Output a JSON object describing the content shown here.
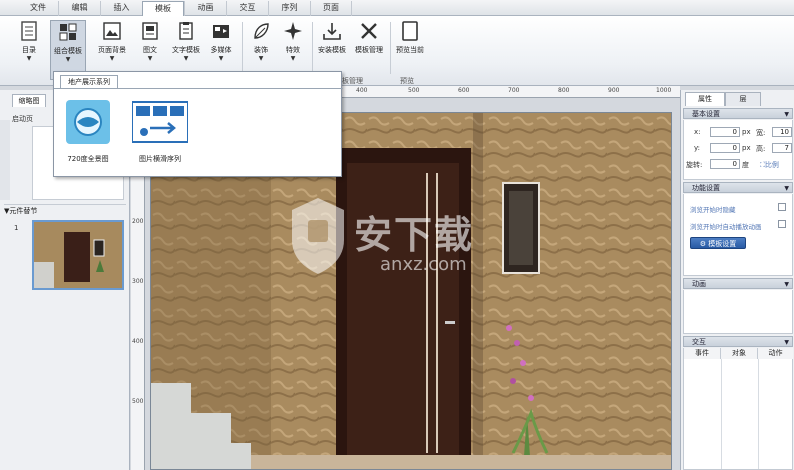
{
  "menu": {
    "tabs": [
      "文件",
      "编辑",
      "插入",
      "模板",
      "动画",
      "交互",
      "序列",
      "页面"
    ],
    "active": "模板"
  },
  "ribbon": {
    "buttons": [
      {
        "label": "目录"
      },
      {
        "label": "组合模板"
      },
      {
        "label": "页面背景"
      },
      {
        "label": "图文"
      },
      {
        "label": "文字模板"
      },
      {
        "label": "多媒体"
      },
      {
        "label": "装饰"
      },
      {
        "label": "特效"
      },
      {
        "label": "安装模板"
      },
      {
        "label": "模板管理"
      },
      {
        "label": "预览当前"
      }
    ],
    "groups": [
      "板管理",
      "预览"
    ]
  },
  "popup": {
    "tab": "地产展示系列",
    "items": [
      {
        "label": "720度全景图"
      },
      {
        "label": "图片横滑序列"
      }
    ]
  },
  "left_panel": {
    "tab": "缩略图",
    "start_page": "启动页",
    "section": "元件替节",
    "page_number": "1"
  },
  "ruler": {
    "h": [
      "400",
      "500",
      "600",
      "700",
      "800",
      "900",
      "1000"
    ],
    "v": [
      "100",
      "200",
      "300",
      "400",
      "500"
    ]
  },
  "watermark": {
    "text": "安下载",
    "url": "anxz.com"
  },
  "right_panel": {
    "tabs": [
      "属性",
      "层"
    ],
    "basic": {
      "title": "基本设置",
      "x_label": "x:",
      "x_value": "0",
      "x_unit": "px",
      "w_label": "宽:",
      "w_value": "10",
      "y_label": "y:",
      "y_value": "0",
      "y_unit": "px",
      "h_label": "高:",
      "h_value": "7",
      "rot_label": "旋转:",
      "rot_value": "0",
      "rot_unit": "度",
      "ratio_label": "比例"
    },
    "function": {
      "title": "功能设置",
      "opt1": "浏览开始时隐藏",
      "opt2": "浏览开始时自动播放动画",
      "button": "模板设置"
    },
    "animation": {
      "title": "动画"
    },
    "interaction": {
      "title": "交互",
      "columns": [
        "事件",
        "对象",
        "动作"
      ]
    }
  },
  "colors": {
    "accent": "#285aa4",
    "ribbon_bg": "#f4f6f9",
    "panel_bg": "#eef0f3",
    "wall": "#a98b5f",
    "door": "#3a1f18"
  }
}
